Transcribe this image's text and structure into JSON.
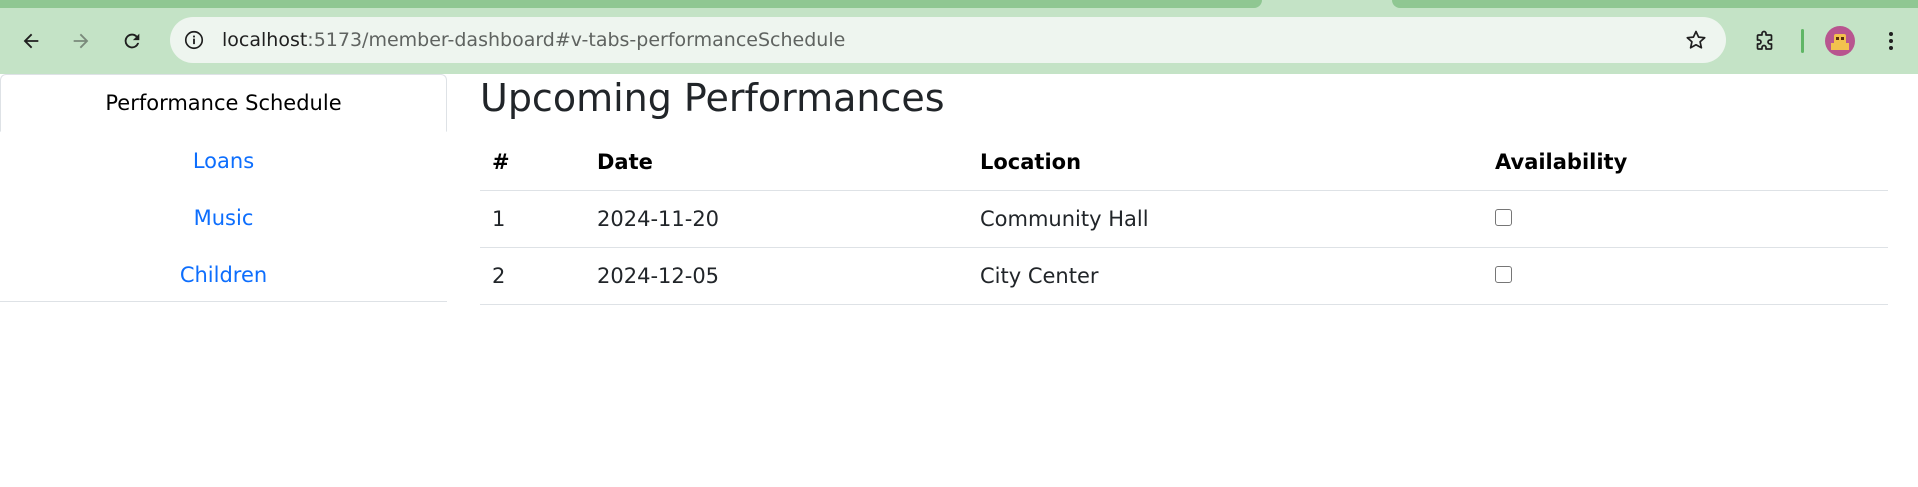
{
  "browser": {
    "url_host": "localhost",
    "url_path": ":5173/member-dashboard#v-tabs-performanceSchedule",
    "icons": {
      "back": "back-arrow-icon",
      "forward": "forward-arrow-icon",
      "reload": "reload-icon",
      "site_info": "site-info-icon",
      "bookmark": "star-icon",
      "extensions": "puzzle-icon",
      "menu": "more-vert-icon"
    },
    "colors": {
      "frame": "#c4e3c6",
      "omnibox": "#eef5ef",
      "accent": "#5fb665"
    }
  },
  "sidebar": {
    "items": [
      {
        "label": "Performance Schedule",
        "active": true
      },
      {
        "label": "Loans",
        "active": false
      },
      {
        "label": "Music",
        "active": false
      },
      {
        "label": "Children",
        "active": false
      }
    ],
    "link_color": "#0d6efd"
  },
  "main": {
    "title": "Upcoming Performances",
    "table": {
      "headers": [
        "#",
        "Date",
        "Location",
        "Availability"
      ],
      "rows": [
        {
          "num": "1",
          "date": "2024-11-20",
          "location": "Community Hall",
          "available": false
        },
        {
          "num": "2",
          "date": "2024-12-05",
          "location": "City Center",
          "available": false
        }
      ]
    }
  }
}
